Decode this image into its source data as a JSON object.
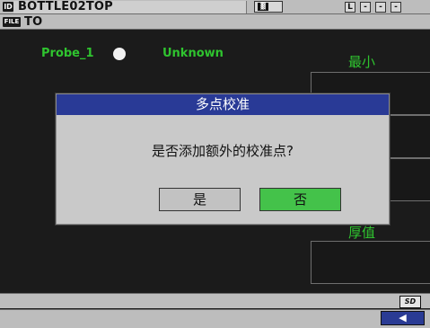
{
  "header": {
    "id_tag": "ID",
    "id_value": "BOTTLE02TOP",
    "file_tag": "FILE",
    "file_value": "TO",
    "slots": [
      "L",
      "-",
      "-",
      "-"
    ]
  },
  "probe": {
    "name": "Probe_1",
    "status": "Unknown"
  },
  "side": {
    "label_top": "最小",
    "label_bottom": "厚值"
  },
  "dialog": {
    "title": "多点校准",
    "message": "是否添加额外的校准点?",
    "yes_label": "是",
    "no_label": "否"
  },
  "footer": {
    "sd_label": "SD",
    "nav_icon": "back-arrow-icon",
    "nav_glyph": "◀"
  },
  "colors": {
    "accent_green": "#2fc42f",
    "dialog_title_bg": "#293a96",
    "selected_button_bg": "#44c24a"
  }
}
